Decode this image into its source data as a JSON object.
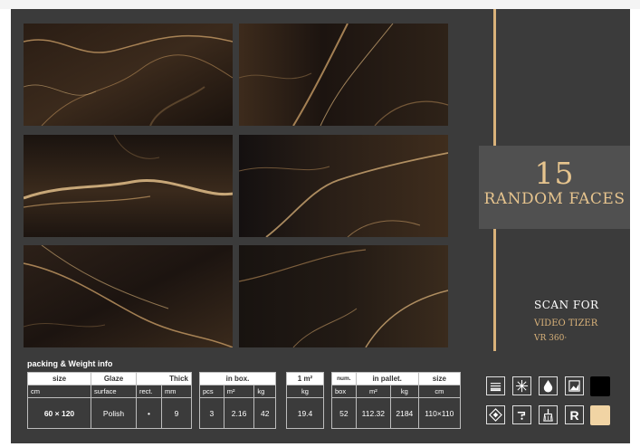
{
  "faces": {
    "number": "15",
    "label": "RANDOM FACES"
  },
  "scan": {
    "title": "SCAN FOR",
    "line1": "VIDEO TIZER",
    "line2": "VR 360·"
  },
  "packing": {
    "title": "packing & Weight info",
    "size_table": {
      "headers": [
        "size",
        "Glaze",
        "Thick"
      ],
      "sub": [
        "cm",
        "surface",
        "rect.",
        "mm"
      ],
      "values": [
        "60 × 120",
        "Polish",
        "•",
        "9"
      ]
    },
    "box_table": {
      "header": "in box.",
      "sub": [
        "pcs",
        "m²",
        "kg"
      ],
      "values": [
        "3",
        "2.16",
        "42"
      ]
    },
    "m2_table": {
      "header": "1 m²",
      "sub": [
        "kg"
      ],
      "values": [
        "19.4"
      ]
    },
    "pallet_table": {
      "headers": [
        "num.",
        "in pallet.",
        "size"
      ],
      "sub": [
        "box",
        "m²",
        "kg",
        "cm"
      ],
      "values": [
        "52",
        "112.32",
        "2184",
        "110×110"
      ]
    }
  },
  "icons": {
    "row1": [
      "layers-icon",
      "snowflake-icon",
      "water-drop-icon",
      "image-icon"
    ],
    "row2": [
      "diamond-icon",
      "faucet-icon",
      "brush-icon",
      "r-icon"
    ],
    "r_letter": "R",
    "swatches": [
      "#000000",
      "#f1d4a4"
    ]
  }
}
